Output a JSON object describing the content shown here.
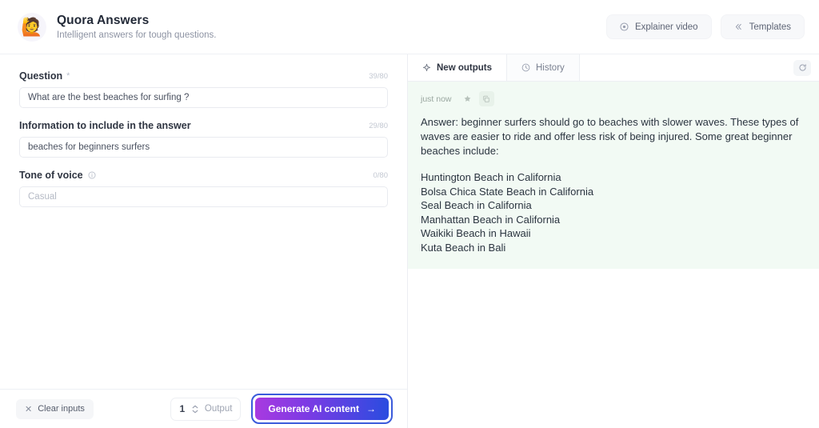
{
  "header": {
    "emoji": "🙋",
    "title": "Quora Answers",
    "subtitle": "Intelligent answers for tough questions.",
    "actions": [
      {
        "label": "Explainer video",
        "icon": "play-circle-icon"
      },
      {
        "label": "Templates",
        "icon": "chevrons-left-icon"
      }
    ]
  },
  "form": {
    "fields": [
      {
        "label": "Question",
        "required_mark": "*",
        "counter": "39/80",
        "value": "What are the best beaches for surfing ?",
        "placeholder": "",
        "is_placeholder": false,
        "has_info": false
      },
      {
        "label": "Information to include in the answer",
        "required_mark": "",
        "counter": "29/80",
        "value": "beaches for beginners surfers",
        "placeholder": "",
        "is_placeholder": false,
        "has_info": false
      },
      {
        "label": "Tone of voice",
        "required_mark": "",
        "counter": "0/80",
        "value": "",
        "placeholder": "Casual",
        "is_placeholder": true,
        "has_info": true
      }
    ]
  },
  "footer": {
    "clear_label": "Clear inputs",
    "output_count": "1",
    "output_label": "Output",
    "generate_label": "Generate AI content",
    "generate_arrow": "→",
    "accent_gradient_from": "#a83ae0",
    "accent_gradient_to": "#2a4ce0",
    "focus_ring_color": "#3b5bdb"
  },
  "panel": {
    "tabs": [
      {
        "label": "New outputs",
        "icon": "sparkle-icon",
        "active": true
      },
      {
        "label": "History",
        "icon": "clock-icon",
        "active": false
      }
    ],
    "refresh_icon": "refresh-icon",
    "card_background": "#f2faf4",
    "output": {
      "time": "just now",
      "favorite_icon": "star-icon",
      "copy_icon": "copy-icon",
      "paragraph": "Answer: beginner surfers should go to beaches with slower waves. These types of waves are easier to ride and offer less risk of being injured. Some great beginner beaches include:",
      "items": [
        "Huntington Beach in California",
        "Bolsa Chica State Beach in California",
        "Seal Beach in California",
        "Manhattan Beach in California",
        "Waikiki Beach in Hawaii",
        "Kuta Beach in Bali"
      ]
    }
  }
}
